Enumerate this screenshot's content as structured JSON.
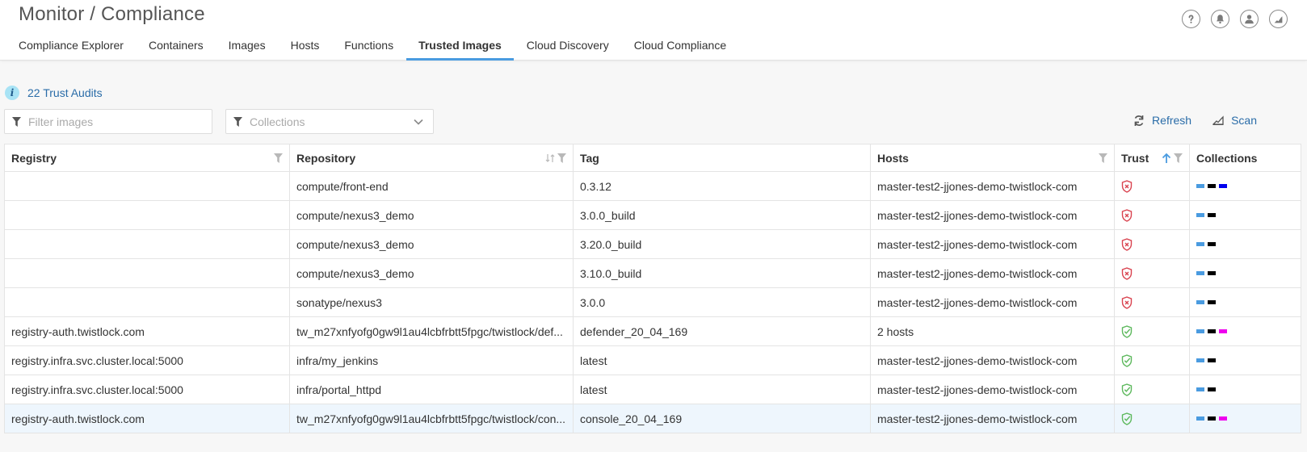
{
  "header": {
    "title": "Monitor / Compliance",
    "tabs": [
      {
        "label": "Compliance Explorer",
        "active": false
      },
      {
        "label": "Containers",
        "active": false
      },
      {
        "label": "Images",
        "active": false
      },
      {
        "label": "Hosts",
        "active": false
      },
      {
        "label": "Functions",
        "active": false
      },
      {
        "label": "Trusted Images",
        "active": true
      },
      {
        "label": "Cloud Discovery",
        "active": false
      },
      {
        "label": "Cloud Compliance",
        "active": false
      }
    ],
    "icons": [
      "help-icon",
      "bell-icon",
      "user-icon",
      "chart-icon"
    ]
  },
  "audits": {
    "label": "22 Trust Audits"
  },
  "filters": {
    "images_placeholder": "Filter images",
    "images_value": "",
    "collections_placeholder": "Collections"
  },
  "actions": {
    "refresh_label": "Refresh",
    "scan_label": "Scan"
  },
  "colors": {
    "accent": "#4a9be0",
    "link": "#2a6ca8",
    "untrusted": "#d9434f",
    "trusted": "#5cb85c",
    "chip_blue_light": "#4a9be0",
    "chip_black": "#000000",
    "chip_blue": "#0000ee",
    "chip_magenta": "#ee00ee"
  },
  "table": {
    "columns": [
      {
        "label": "Registry",
        "filter": true,
        "sort": "none"
      },
      {
        "label": "Repository",
        "filter": true,
        "sort": "sortable"
      },
      {
        "label": "Tag",
        "filter": false,
        "sort": "none"
      },
      {
        "label": "Hosts",
        "filter": true,
        "sort": "none"
      },
      {
        "label": "Trust",
        "filter": true,
        "sort": "asc"
      },
      {
        "label": "Collections",
        "filter": false,
        "sort": "none"
      }
    ],
    "rows": [
      {
        "registry": "",
        "repository": "compute/front-end",
        "tag": "0.3.12",
        "hosts": "master-test2-jjones-demo-twistlock-com",
        "trust": "untrusted",
        "collections": [
          "#4a9be0",
          "#000000",
          "#0000ee"
        ],
        "selected": false
      },
      {
        "registry": "",
        "repository": "compute/nexus3_demo",
        "tag": "3.0.0_build",
        "hosts": "master-test2-jjones-demo-twistlock-com",
        "trust": "untrusted",
        "collections": [
          "#4a9be0",
          "#000000"
        ],
        "selected": false
      },
      {
        "registry": "",
        "repository": "compute/nexus3_demo",
        "tag": "3.20.0_build",
        "hosts": "master-test2-jjones-demo-twistlock-com",
        "trust": "untrusted",
        "collections": [
          "#4a9be0",
          "#000000"
        ],
        "selected": false
      },
      {
        "registry": "",
        "repository": "compute/nexus3_demo",
        "tag": "3.10.0_build",
        "hosts": "master-test2-jjones-demo-twistlock-com",
        "trust": "untrusted",
        "collections": [
          "#4a9be0",
          "#000000"
        ],
        "selected": false
      },
      {
        "registry": "",
        "repository": "sonatype/nexus3",
        "tag": "3.0.0",
        "hosts": "master-test2-jjones-demo-twistlock-com",
        "trust": "untrusted",
        "collections": [
          "#4a9be0",
          "#000000"
        ],
        "selected": false
      },
      {
        "registry": "registry-auth.twistlock.com",
        "repository": "tw_m27xnfyofg0gw9l1au4lcbfrbtt5fpgc/twistlock/def...",
        "tag": "defender_20_04_169",
        "hosts": "2 hosts",
        "trust": "trusted",
        "collections": [
          "#4a9be0",
          "#000000",
          "#ee00ee"
        ],
        "selected": false
      },
      {
        "registry": "registry.infra.svc.cluster.local:5000",
        "repository": "infra/my_jenkins",
        "tag": "latest",
        "hosts": "master-test2-jjones-demo-twistlock-com",
        "trust": "trusted",
        "collections": [
          "#4a9be0",
          "#000000"
        ],
        "selected": false
      },
      {
        "registry": "registry.infra.svc.cluster.local:5000",
        "repository": "infra/portal_httpd",
        "tag": "latest",
        "hosts": "master-test2-jjones-demo-twistlock-com",
        "trust": "trusted",
        "collections": [
          "#4a9be0",
          "#000000"
        ],
        "selected": false
      },
      {
        "registry": "registry-auth.twistlock.com",
        "repository": "tw_m27xnfyofg0gw9l1au4lcbfrbtt5fpgc/twistlock/con...",
        "tag": "console_20_04_169",
        "hosts": "master-test2-jjones-demo-twistlock-com",
        "trust": "trusted",
        "collections": [
          "#4a9be0",
          "#000000",
          "#ee00ee"
        ],
        "selected": true
      }
    ]
  }
}
